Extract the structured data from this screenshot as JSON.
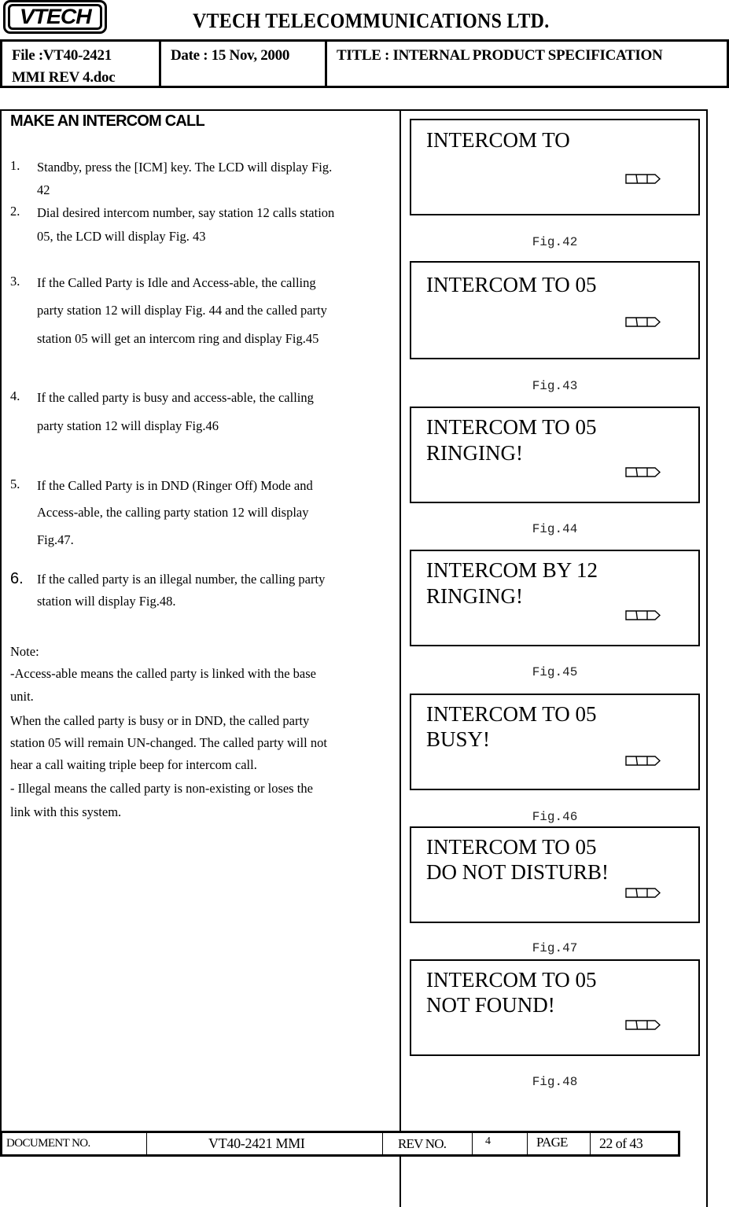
{
  "header": {
    "logo_text": "VTECH",
    "company": "VTECH  TELECOMMUNICATIONS  LTD.",
    "file_line1": "File :VT40-2421",
    "file_line2": "MMI REV 4.doc",
    "date": "Date :  15 Nov, 2000",
    "title": "TITLE : INTERNAL PRODUCT SPECIFICATION"
  },
  "section": {
    "title": "MAKE AN INTERCOM CALL",
    "steps": [
      {
        "num": "1.",
        "lines": [
          "Standby, press the [ICM] key. The LCD will display Fig.",
          "42"
        ]
      },
      {
        "num": "2.",
        "lines": [
          "Dial desired intercom number, say station 12 calls station",
          "05, the LCD will display Fig. 43"
        ]
      },
      {
        "num": "3.",
        "lines": [
          "If the Called Party is Idle and  Access-able, the calling",
          "party station 12 will display Fig. 44 and the called party",
          "station 05 will get an intercom ring and display Fig.45"
        ]
      },
      {
        "num": "4.",
        "lines": [
          "If the called party is busy and access-able, the calling",
          "party station 12 will display Fig.46"
        ]
      },
      {
        "num": "5.",
        "lines": [
          "If the Called Party is in DND (Ringer Off) Mode and",
          "Access-able, the calling party station 12 will display",
          "Fig.47."
        ]
      },
      {
        "num": "6.",
        "lines": [
          "If the called party is an illegal number, the calling party",
          "station will display Fig.48."
        ]
      }
    ],
    "note_lines": [
      "Note:",
      "-Access-able means the called party is linked with the base",
      "unit.",
      "When the called party is busy or in DND, the called party",
      "station 05 will remain UN-changed. The called party will not",
      "hear a call waiting triple beep for intercom call.",
      "- Illegal means the called party is non-existing or loses the",
      "link with this system."
    ]
  },
  "figures": [
    {
      "caption": "Fig.42",
      "line1": "INTERCOM TO",
      "line2": "",
      "icon": "battery-icon"
    },
    {
      "caption": "Fig.43",
      "line1": "INTERCOM TO 05",
      "line2": "",
      "icon": "battery-icon"
    },
    {
      "caption": "Fig.44",
      "line1": "INTERCOM TO 05",
      "line2": "RINGING!",
      "icon": "battery-icon"
    },
    {
      "caption": "Fig.45",
      "line1": "INTERCOM BY 12",
      "line2": "RINGING!",
      "icon": "battery-icon"
    },
    {
      "caption": "Fig.46",
      "line1": "INTERCOM TO 05",
      "line2": "BUSY!",
      "icon": "battery-icon"
    },
    {
      "caption": "Fig.47",
      "line1": "INTERCOM TO 05",
      "line2": "DO NOT DISTURB!",
      "icon": "battery-icon"
    },
    {
      "caption": "Fig.48",
      "line1": "INTERCOM TO 05",
      "line2": "NOT FOUND!",
      "icon": "battery-icon"
    }
  ],
  "footer": {
    "doc_label": "DOCUMENT NO.",
    "doc_value": "VT40-2421 MMI",
    "rev_label": "REV NO.",
    "rev_value": "4",
    "page_label": "PAGE",
    "page_value": "22 of 43"
  }
}
